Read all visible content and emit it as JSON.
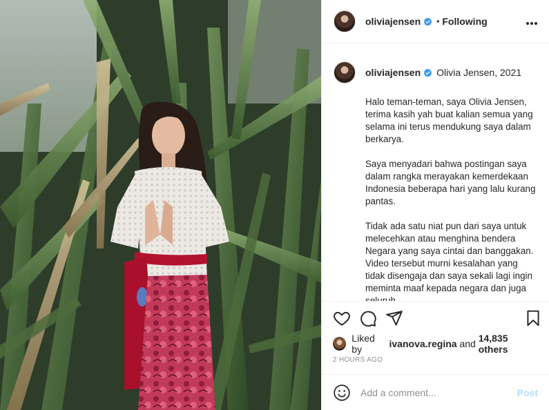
{
  "post": {
    "image_alt": "Woman in white lace kebaya and red batik skirt standing in front of palm leaves",
    "author": {
      "username": "oliviajensen",
      "verified": true,
      "follow_status": "Following",
      "separator": "•"
    },
    "more_icon": "more-options-icon",
    "caption": {
      "username": "oliviajensen",
      "title": "Olivia Jensen, 2021",
      "paragraphs": [
        "Halo teman-teman, saya Olivia Jensen, terima kasih yah buat kalian semua yang selama ini terus mendukung saya dalam berkarya.",
        "Saya menyadari bahwa postingan saya dalam rangka merayakan kemerdekaan Indonesia beberapa hari yang lalu kurang pantas.",
        "Tidak ada satu niat pun dari saya untuk melecehkan atau menghina bendera Negara yang saya cintai dan banggakan. Video tersebut murni kesalahan yang tidak disengaja dan saya sekali lagi ingin meminta maaf kepada negara dan juga seluruh"
      ]
    },
    "actions": {
      "like_icon": "heart-icon",
      "comment_icon": "comment-icon",
      "share_icon": "share-icon",
      "save_icon": "bookmark-icon"
    },
    "likes": {
      "prefix": "Liked by",
      "liker": "ivanova.regina",
      "middle": "and",
      "others": "14,835 others"
    },
    "timestamp": "2 HOURS AGO",
    "comment_box": {
      "emoji_icon": "emoji-icon",
      "placeholder": "Add a comment...",
      "post_label": "Post"
    }
  },
  "colors": {
    "verified_blue": "#3897f0",
    "post_disabled": "#b2dffc",
    "muted_text": "#8e8e8e",
    "border": "#efefef"
  }
}
